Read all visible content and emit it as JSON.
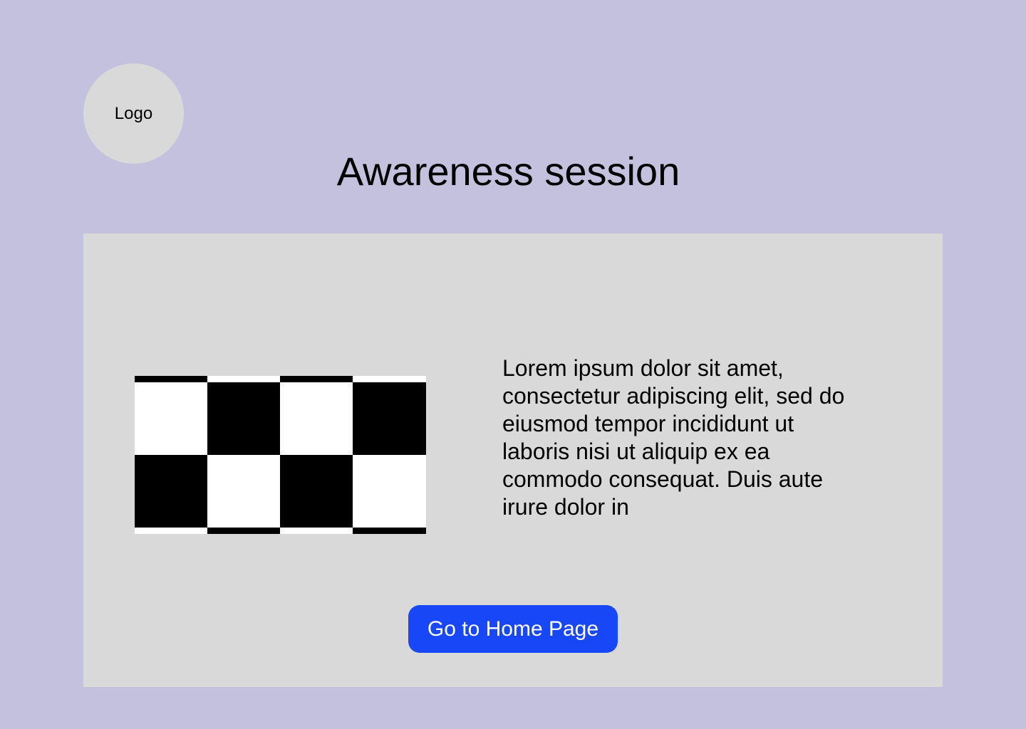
{
  "logo": {
    "label": "Logo"
  },
  "header": {
    "title": "Awareness session"
  },
  "content": {
    "image_name": "checkerboard-image",
    "text": "Lorem ipsum dolor sit amet, consectetur adipiscing elit, sed do eiusmod tempor incididunt ut laboris nisi ut aliquip ex ea commodo consequat. Duis aute irure dolor in"
  },
  "actions": {
    "home_button_label": "Go to Home Page"
  },
  "colors": {
    "page_background": "#c4c1de",
    "card_background": "#d9d9d9",
    "logo_background": "#d9d9d9",
    "button_background": "#1847f7",
    "button_text": "#ffffff"
  }
}
